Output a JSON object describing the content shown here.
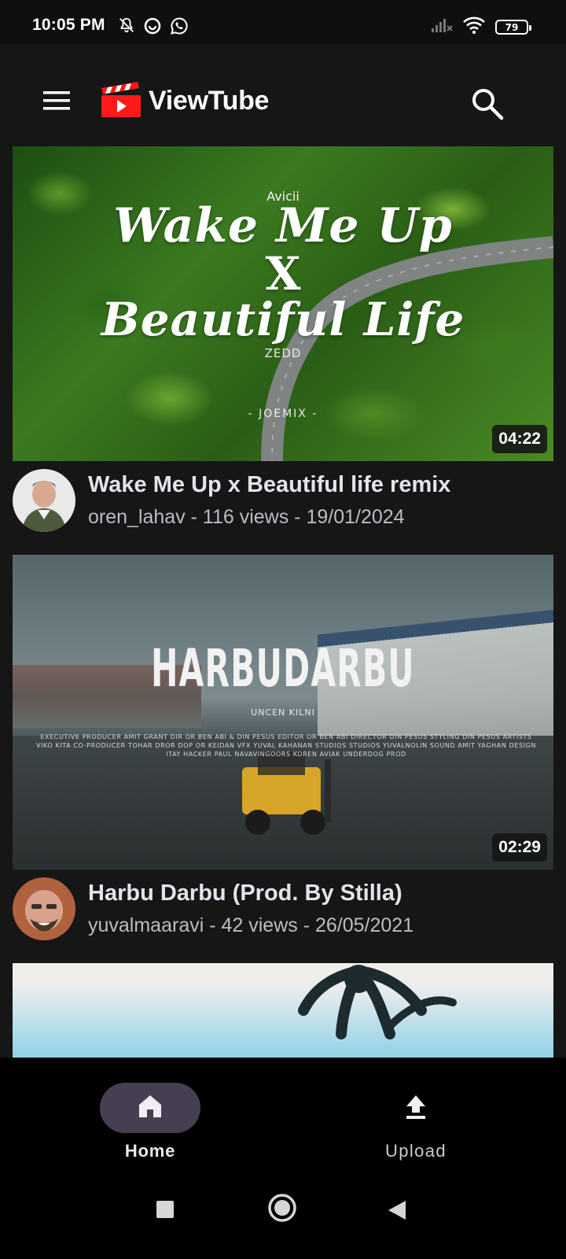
{
  "status_bar": {
    "time": "10:05 PM",
    "battery": "79",
    "left_icons": [
      "mute-bell-icon",
      "data-saver-icon",
      "whatsapp-icon"
    ],
    "right_icons": [
      "signal-icon",
      "wifi-icon",
      "battery-icon"
    ]
  },
  "app_bar": {
    "title": "ViewTube",
    "menu_icon": "hamburger-menu-icon",
    "search_icon": "search-icon",
    "brand_color": "#ff0000"
  },
  "videos": [
    {
      "title": "Wake Me Up x Beautiful life remix",
      "meta": "oren_lahav - 116 views - 19/01/2024",
      "duration": "04:22",
      "thumbnail_text": {
        "artist": "Avicii",
        "line1": "Wake Me Up",
        "x": "X",
        "line2": "Beautiful Life",
        "artist2": "ZEDD",
        "tag": "- JOEMIX -"
      }
    },
    {
      "title": "Harbu Darbu (Prod. By Stilla)",
      "meta": "yuvalmaaravi - 42 views - 26/05/2021",
      "duration": "02:29",
      "thumbnail_text": {
        "title": "HARBUDARBU",
        "subtitle": "UNCEN KILNI",
        "credits": "EXECUTIVE PRODUCER AMIT GRANT  DIR OR BEN ABI & DIN PESUS  EDITOR OR BEN ABI  DIRECTOR DIN PESUS  STYLING DIN PESUS  ARTISTS VIKO KITA  CO-PRODUCER TOHAR DROR  DOP OR KEIDAN  VFX YUVAL KAHANAN  STUDIOS STUDIOS  YUVALNOLIN  SOUND AMIT YAGHAN  DESIGN ITAY HACKER  PAUL NAVAVINGOORS  KOREN AVIAK  UNDERDOG PROD"
      }
    },
    {
      "title": "",
      "meta": "",
      "duration": ""
    }
  ],
  "bottom_nav": {
    "items": [
      {
        "label": "Home",
        "icon": "home-icon",
        "active": true
      },
      {
        "label": "Upload",
        "icon": "upload-icon",
        "active": false
      }
    ],
    "active_pill_color": "#463f52"
  },
  "system_nav": {
    "buttons": [
      "recents-square-icon",
      "home-circle-icon",
      "back-triangle-icon"
    ]
  }
}
